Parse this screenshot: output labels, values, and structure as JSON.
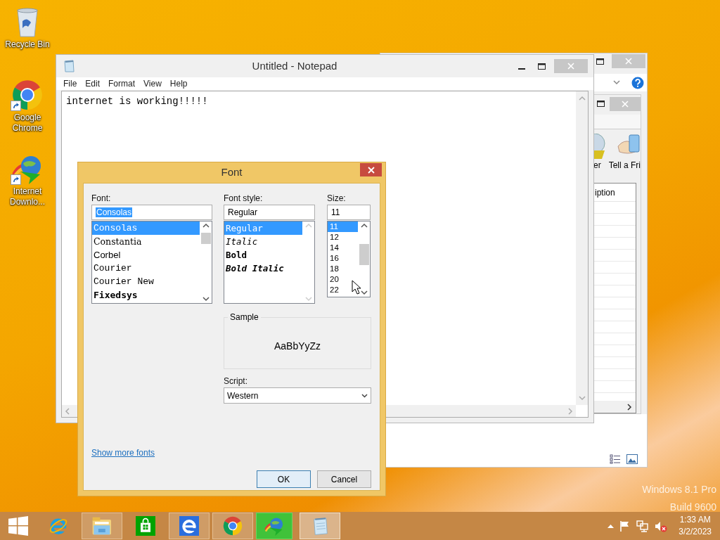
{
  "desktop_icons": [
    {
      "label": "Recycle Bin",
      "kind": "recycle-bin",
      "shortcut": false
    },
    {
      "label": "Google Chrome",
      "kind": "chrome",
      "shortcut": true
    },
    {
      "label": "Internet Downlo...",
      "kind": "idm",
      "shortcut": true
    }
  ],
  "background_window": {
    "toolbar_labels": [
      "er",
      "Tell a Fri"
    ],
    "column_header": "iption"
  },
  "notepad": {
    "title": "Untitled - Notepad",
    "menu": [
      "File",
      "Edit",
      "Format",
      "View",
      "Help"
    ],
    "text": "internet is working!!!!!"
  },
  "font_dialog": {
    "title": "Font",
    "font_label": "Font:",
    "font_value": "Consolas",
    "font_value_highlighted": true,
    "fonts": [
      {
        "name": "Consolas",
        "kind": "mono",
        "selected": true
      },
      {
        "name": "Constantia",
        "kind": "serif",
        "selected": false
      },
      {
        "name": "Corbel",
        "kind": "sans",
        "selected": false
      },
      {
        "name": "Courier",
        "kind": "mono",
        "selected": false
      },
      {
        "name": "Courier New",
        "kind": "mono",
        "selected": false
      },
      {
        "name": "Fixedsys",
        "kind": "mono-bold",
        "selected": false
      }
    ],
    "style_label": "Font style:",
    "style_value": "Regular",
    "styles": [
      {
        "name": "Regular",
        "kind": "regular",
        "selected": true
      },
      {
        "name": "Italic",
        "kind": "italic",
        "selected": false
      },
      {
        "name": "Bold",
        "kind": "bold",
        "selected": false
      },
      {
        "name": "Bold Italic",
        "kind": "bold-italic",
        "selected": false
      }
    ],
    "size_label": "Size:",
    "size_value": "11",
    "sizes": [
      {
        "name": "11",
        "selected": true
      },
      {
        "name": "12",
        "selected": false
      },
      {
        "name": "14",
        "selected": false
      },
      {
        "name": "16",
        "selected": false
      },
      {
        "name": "18",
        "selected": false
      },
      {
        "name": "20",
        "selected": false
      },
      {
        "name": "22",
        "selected": false
      }
    ],
    "sample_label": "Sample",
    "sample_text": "AaBbYyZz",
    "script_label": "Script:",
    "script_value": "Western",
    "show_more_link": "Show more fonts",
    "buttons": [
      {
        "label": "OK",
        "default": true
      },
      {
        "label": "Cancel",
        "default": false
      }
    ]
  },
  "watermark": [
    "Windows 8.1 Pro",
    "Build 9600"
  ],
  "taskbar": {
    "apps": [
      {
        "kind": "ie",
        "running": false,
        "active": false,
        "progress": false
      },
      {
        "kind": "explorer",
        "running": true,
        "active": false,
        "progress": false
      },
      {
        "kind": "store",
        "running": false,
        "active": false,
        "progress": false
      },
      {
        "kind": "ie-modern",
        "running": true,
        "active": false,
        "progress": false
      },
      {
        "kind": "chrome",
        "running": true,
        "active": false,
        "progress": false
      },
      {
        "kind": "idm",
        "running": true,
        "active": false,
        "progress": true
      },
      {
        "kind": "notepad",
        "running": true,
        "active": true,
        "progress": false
      }
    ],
    "time": "1:33 AM",
    "date": "3/2/2023"
  }
}
